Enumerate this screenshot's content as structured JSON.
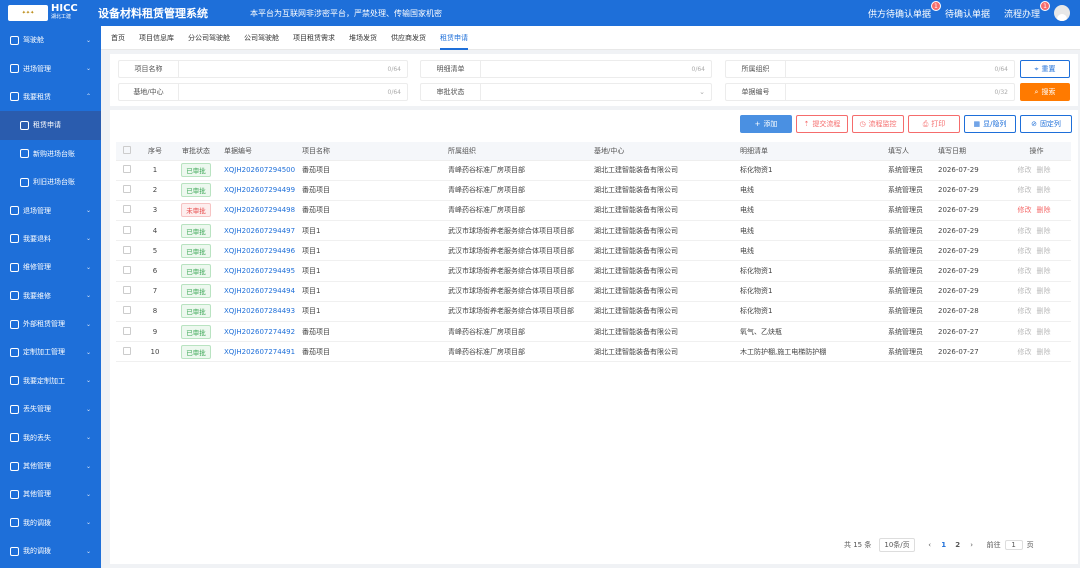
{
  "header": {
    "logo_text": "湖北工建",
    "logo_brand": "HICC",
    "title": "设备材料租赁管理系统",
    "notice": "本平台为互联网非涉密平台，严禁处理、传输国家机密",
    "links": [
      {
        "label": "供方待确认单据",
        "badge": "1"
      },
      {
        "label": "待确认单据",
        "badge": ""
      },
      {
        "label": "流程办理",
        "badge": "1"
      }
    ]
  },
  "sidebar": {
    "items": [
      {
        "label": "驾驶舱",
        "icon": "dashboard-icon",
        "chevron": "⌄"
      },
      {
        "label": "进场管理",
        "icon": "entry-icon",
        "chevron": "⌄"
      },
      {
        "label": "我要租赁",
        "icon": "lease-icon",
        "chevron": "⌃"
      },
      {
        "label": "租赁申请",
        "icon": "apply-icon",
        "chevron": "",
        "sub": true,
        "active": true
      },
      {
        "label": "新购进场台账",
        "icon": "ledger-icon",
        "chevron": "",
        "sub": true
      },
      {
        "label": "利旧进场台账",
        "icon": "home-icon",
        "chevron": "",
        "sub": true
      },
      {
        "label": "退场管理",
        "icon": "exit-icon",
        "chevron": "⌄"
      },
      {
        "label": "我要退料",
        "icon": "return-icon",
        "chevron": "⌄"
      },
      {
        "label": "维修管理",
        "icon": "repair-icon",
        "chevron": "⌄"
      },
      {
        "label": "我要维修",
        "icon": "wrench-icon",
        "chevron": "⌄"
      },
      {
        "label": "外部租赁管理",
        "icon": "external-icon",
        "chevron": "⌄"
      },
      {
        "label": "定制加工管理",
        "icon": "custom-icon",
        "chevron": "⌄"
      },
      {
        "label": "我要定制加工",
        "icon": "custom-order-icon",
        "chevron": "⌄"
      },
      {
        "label": "丢失管理",
        "icon": "lost-icon",
        "chevron": "⌄"
      },
      {
        "label": "我的丢失",
        "icon": "my-lost-icon",
        "chevron": "⌄"
      },
      {
        "label": "其他管理",
        "icon": "other-icon",
        "chevron": "⌄"
      },
      {
        "label": "其他管理",
        "icon": "other-icon",
        "chevron": "⌄"
      },
      {
        "label": "我的调拨",
        "icon": "transfer-icon",
        "chevron": "⌄"
      },
      {
        "label": "我的调拨",
        "icon": "transfer-icon",
        "chevron": "⌄"
      },
      {
        "label": "报表管理",
        "icon": "report-icon",
        "chevron": "⌄"
      }
    ]
  },
  "tabs": [
    "首页",
    "项目信息库",
    "分公司驾驶舱",
    "公司驾驶舱",
    "项目租赁需求",
    "堆场发货",
    "供应商发货",
    "租赁申请"
  ],
  "filter": {
    "fields": [
      {
        "label": "项目名称",
        "count": "0/64",
        "chevron": ""
      },
      {
        "label": "明细清单",
        "count": "0/64",
        "chevron": ""
      },
      {
        "label": "所属组织",
        "count": "0/64",
        "chevron": ""
      },
      {
        "label": "基地/中心",
        "count": "0/64",
        "chevron": ""
      },
      {
        "label": "审批状态",
        "count": "",
        "chevron": "⌄"
      },
      {
        "label": "单据编号",
        "count": "0/32",
        "chevron": ""
      }
    ],
    "reset_label": "重置",
    "search_label": "搜索"
  },
  "actions": {
    "add": "添加",
    "submit": "提交流程",
    "monitor": "流程监控",
    "print": "打印",
    "show_hide": "显/隐列",
    "pin": "固定列"
  },
  "table": {
    "headers": [
      "序号",
      "审批状态",
      "单据编号",
      "项目名称",
      "所属组织",
      "基地/中心",
      "明细清单",
      "填写人",
      "填写日期",
      "操作"
    ],
    "rows": [
      {
        "no": "1",
        "status": "已审批",
        "code": "XQJH202607294500",
        "project": "番茄项目",
        "org": "青峰药谷标准厂房项目部",
        "base": "湖北工建智能装备有限公司",
        "detail": "标化物资1",
        "author": "系统管理员",
        "date": "2026-07-29",
        "edit": "修改",
        "del": "删除",
        "active": false
      },
      {
        "no": "2",
        "status": "已审批",
        "code": "XQJH202607294499",
        "project": "番茄项目",
        "org": "青峰药谷标准厂房项目部",
        "base": "湖北工建智能装备有限公司",
        "detail": "电线",
        "author": "系统管理员",
        "date": "2026-07-29",
        "edit": "修改",
        "del": "删除",
        "active": false
      },
      {
        "no": "3",
        "status": "未审批",
        "code": "XQJH202607294498",
        "project": "番茄项目",
        "org": "青峰药谷标准厂房项目部",
        "base": "湖北工建智能装备有限公司",
        "detail": "电线",
        "author": "系统管理员",
        "date": "2026-07-29",
        "edit": "修改",
        "del": "删除",
        "active": true
      },
      {
        "no": "4",
        "status": "已审批",
        "code": "XQJH202607294497",
        "project": "项目1",
        "org": "武汉市球场街养老服务综合体项目项目部",
        "base": "湖北工建智能装备有限公司",
        "detail": "电线",
        "author": "系统管理员",
        "date": "2026-07-29",
        "edit": "修改",
        "del": "删除",
        "active": false
      },
      {
        "no": "5",
        "status": "已审批",
        "code": "XQJH202607294496",
        "project": "项目1",
        "org": "武汉市球场街养老服务综合体项目项目部",
        "base": "湖北工建智能装备有限公司",
        "detail": "电线",
        "author": "系统管理员",
        "date": "2026-07-29",
        "edit": "修改",
        "del": "删除",
        "active": false
      },
      {
        "no": "6",
        "status": "已审批",
        "code": "XQJH202607294495",
        "project": "项目1",
        "org": "武汉市球场街养老服务综合体项目项目部",
        "base": "湖北工建智能装备有限公司",
        "detail": "标化物资1",
        "author": "系统管理员",
        "date": "2026-07-29",
        "edit": "修改",
        "del": "删除",
        "active": false
      },
      {
        "no": "7",
        "status": "已审批",
        "code": "XQJH202607294494",
        "project": "项目1",
        "org": "武汉市球场街养老服务综合体项目项目部",
        "base": "湖北工建智能装备有限公司",
        "detail": "标化物资1",
        "author": "系统管理员",
        "date": "2026-07-29",
        "edit": "修改",
        "del": "删除",
        "active": false
      },
      {
        "no": "8",
        "status": "已审批",
        "code": "XQJH202607284493",
        "project": "项目1",
        "org": "武汉市球场街养老服务综合体项目项目部",
        "base": "湖北工建智能装备有限公司",
        "detail": "标化物资1",
        "author": "系统管理员",
        "date": "2026-07-28",
        "edit": "修改",
        "del": "删除",
        "active": false
      },
      {
        "no": "9",
        "status": "已审批",
        "code": "XQJH202607274492",
        "project": "番茄项目",
        "org": "青峰药谷标准厂房项目部",
        "base": "湖北工建智能装备有限公司",
        "detail": "氧气、乙炔瓶",
        "author": "系统管理员",
        "date": "2026-07-27",
        "edit": "修改",
        "del": "删除",
        "active": false
      },
      {
        "no": "10",
        "status": "已审批",
        "code": "XQJH202607274491",
        "project": "番茄项目",
        "org": "青峰药谷标准厂房项目部",
        "base": "湖北工建智能装备有限公司",
        "detail": "木工防护棚,施工电梯防护棚",
        "author": "系统管理员",
        "date": "2026-07-27",
        "edit": "修改",
        "del": "删除",
        "active": false
      }
    ]
  },
  "pager": {
    "total": "共 15 条",
    "page_size": "10条/页",
    "prev": "‹",
    "pages": [
      "1",
      "2"
    ],
    "next": "›",
    "goto": "前往",
    "goto_value": "1",
    "page_unit": "页"
  },
  "colors": {
    "primary": "#1e6fd9",
    "accent": "#ff7a00",
    "danger": "#f56c6c",
    "success": "#3aa654"
  }
}
